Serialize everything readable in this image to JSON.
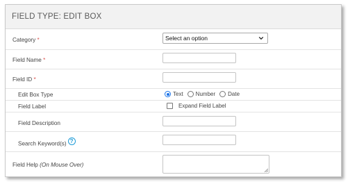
{
  "header": {
    "title": "FIELD TYPE: EDIT BOX"
  },
  "required_mark": "*",
  "category": {
    "label": "Category",
    "selected": "Select an option"
  },
  "field_name": {
    "label": "Field Name",
    "value": ""
  },
  "field_id": {
    "label": "Field ID",
    "value": ""
  },
  "edit_box_type": {
    "label": "Edit Box Type",
    "options": [
      "Text",
      "Number",
      "Date"
    ],
    "selected": "Text"
  },
  "field_label": {
    "label": "Field Label",
    "checkbox_label": "Expand Field Label",
    "checked": false
  },
  "field_description": {
    "label": "Field Description",
    "value": ""
  },
  "search_keywords": {
    "label": "Search Keyword(s)",
    "help_icon": "?",
    "value": ""
  },
  "field_help": {
    "label": "Field Help",
    "label_note": "(On Mouse Over)",
    "value": ""
  },
  "colors": {
    "accent": "#1a73e8",
    "required": "#d9534f",
    "help": "#1e9bd7",
    "header_bg": "#f2f2f2"
  },
  "icons": {
    "select_arrow": "chevron-down-icon",
    "help": "help-circle-icon",
    "textarea_grip": "resize-grip-icon"
  }
}
